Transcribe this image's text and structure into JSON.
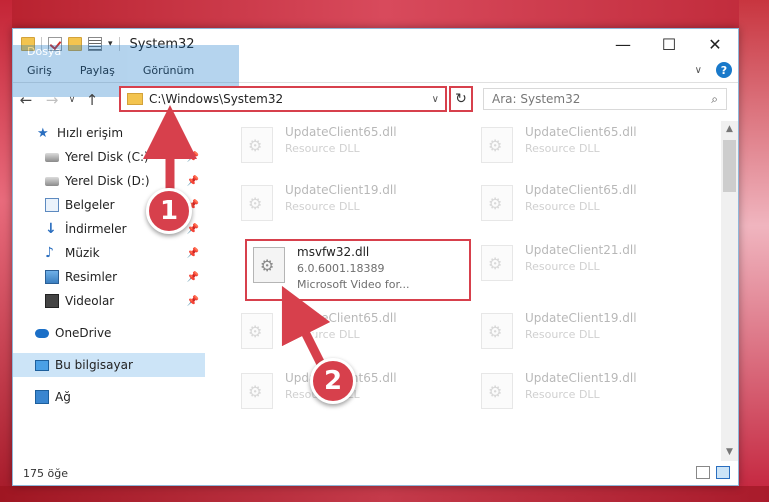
{
  "window": {
    "title": "System32",
    "controls": {
      "minimize": "—",
      "maximize": "☐",
      "close": "✕"
    }
  },
  "ribbon": {
    "tabs": [
      "Dosya",
      "Giriş",
      "Paylaş",
      "Görünüm"
    ],
    "help": "?"
  },
  "address": {
    "path": "C:\\Windows\\System32",
    "search_placeholder": "Ara: System32"
  },
  "sidebar": {
    "quick_access": "Hızlı erişim",
    "pinned": [
      {
        "label": "Yerel Disk (C:)",
        "icon": "disk-icon"
      },
      {
        "label": "Yerel Disk (D:)",
        "icon": "disk-icon"
      },
      {
        "label": "Belgeler",
        "icon": "document-icon"
      },
      {
        "label": "İndirmeler",
        "icon": "download-icon"
      },
      {
        "label": "Müzik",
        "icon": "music-icon"
      },
      {
        "label": "Resimler",
        "icon": "pictures-icon"
      },
      {
        "label": "Videolar",
        "icon": "video-icon"
      }
    ],
    "onedrive": "OneDrive",
    "this_pc": "Bu bilgisayar",
    "network": "Ağ"
  },
  "files": [
    {
      "name": "UpdateClient65.dll",
      "desc": "Resource DLL"
    },
    {
      "name": "UpdateClient65.dll",
      "desc": "Resource DLL"
    },
    {
      "name": "UpdateClient19.dll",
      "desc": "Resource DLL"
    },
    {
      "name": "UpdateClient65.dll",
      "desc": "Resource DLL"
    },
    {
      "name": "msvfw32.dll",
      "version": "6.0.6001.18389",
      "desc": "Microsoft Video for..."
    },
    {
      "name": "UpdateClient21.dll",
      "desc": "Resource DLL"
    },
    {
      "name": "UpdateClient65.dll",
      "desc": "Resource DLL"
    },
    {
      "name": "UpdateClient19.dll",
      "desc": "Resource DLL"
    },
    {
      "name": "UpdateClient65.dll",
      "desc": "Resource DLL"
    },
    {
      "name": "UpdateClient19.dll",
      "desc": "Resource DLL"
    }
  ],
  "status": {
    "count": "175 öğe"
  },
  "callouts": {
    "one": "1",
    "two": "2"
  },
  "colors": {
    "accent": "#1979ca",
    "highlight": "#d7404c",
    "selected": "#cce4f7"
  }
}
